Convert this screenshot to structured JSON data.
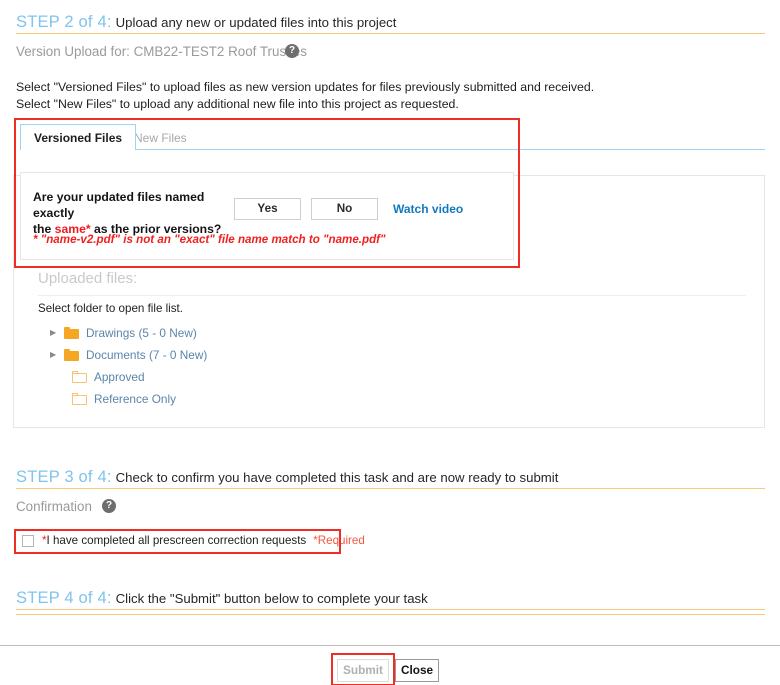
{
  "step2": {
    "label": "STEP 2 of 4:",
    "description": "Upload any new or updated files into this project",
    "subheading": "Version Upload for: CMB22-TEST2 Roof Trusses",
    "help_icon": "help-circle-icon",
    "help_glyph": "?",
    "instructions": [
      "Select \"Versioned Files\" to upload files as new version updates for files previously submitted and received.",
      "Select \"New Files\" to upload any additional new file into this project as requested."
    ],
    "tabs": [
      {
        "label": "Versioned Files",
        "active": true
      },
      {
        "label": "New Files",
        "active": false
      }
    ],
    "question_panel": {
      "question_line1_prefix": "Are your updated files named exactly",
      "question_line2_prefix": "the ",
      "question_emphasis": "same*",
      "question_line2_suffix": " as the prior versions?",
      "yes_label": "Yes",
      "no_label": "No",
      "watch_video_label": "Watch video",
      "warning": "* \"name-v2.pdf\" is not an \"exact\" file name match to \"name.pdf\""
    },
    "files": {
      "title": "Uploaded files:",
      "hint": "Select folder to open file list.",
      "tree": [
        {
          "label": "Drawings (5 - 0 New)",
          "expandable": true,
          "icon": "folder-filled-icon"
        },
        {
          "label": "Documents (7 - 0 New)",
          "expandable": true,
          "icon": "folder-filled-icon"
        },
        {
          "label": "Approved",
          "expandable": false,
          "icon": "folder-outline-icon"
        },
        {
          "label": "Reference Only",
          "expandable": false,
          "icon": "folder-outline-icon"
        }
      ]
    }
  },
  "step3": {
    "label": "STEP 3 of 4:",
    "description": "Check to confirm you have completed this task and are now ready to submit",
    "subheading": "Confirmation",
    "help_icon": "help-circle-icon",
    "help_glyph": "?",
    "checkbox": {
      "checked": false,
      "asterisk": "*",
      "label": "I have completed all prescreen correction requests",
      "required_tag": "*Required"
    }
  },
  "step4": {
    "label": "STEP 4 of 4:",
    "description": "Click the \"Submit\" button below to complete your task"
  },
  "footer": {
    "submit_label": "Submit",
    "submit_disabled": true,
    "close_label": "Close"
  },
  "colors": {
    "step_label": "#7fc4ec",
    "rule_orange": "#fbc87a",
    "tab_active_border": "#9fd4f0",
    "folder_orange": "#f5a623",
    "link_blue": "#1279bf",
    "warning_red": "#f21f1f",
    "highlight_red": "#ee2d24",
    "tree_label": "#5b85aa"
  }
}
